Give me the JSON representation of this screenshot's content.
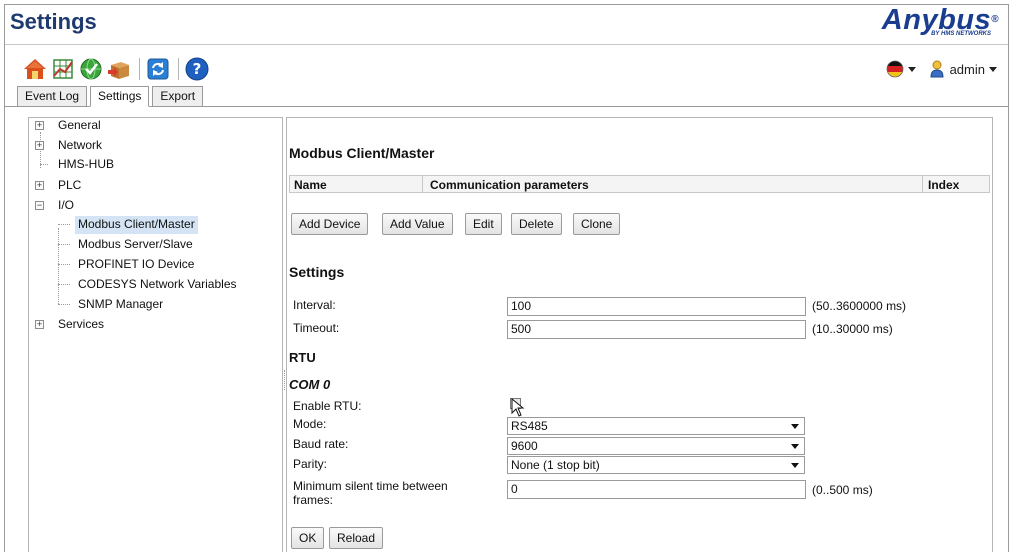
{
  "app": {
    "title": "Settings",
    "logo_text": "Anybus",
    "logo_reg": "®",
    "logo_subtitle": "BY HMS NETWORKS"
  },
  "toolbar": {
    "icons": [
      "home-icon",
      "io-grid-icon",
      "globe-check-icon",
      "box-arrow-icon",
      "refresh-icon",
      "help-icon"
    ]
  },
  "user": {
    "language_icon": "flag-germany-icon",
    "name": "admin"
  },
  "tabs": [
    {
      "label": "Event Log",
      "active": false
    },
    {
      "label": "Settings",
      "active": true
    },
    {
      "label": "Export",
      "active": false
    }
  ],
  "tree": {
    "items": [
      {
        "label": "General",
        "expander": "+"
      },
      {
        "label": "Network",
        "expander": "+"
      },
      {
        "label": "HMS-HUB",
        "expander": ""
      },
      {
        "label": "PLC",
        "expander": "+"
      },
      {
        "label": "I/O",
        "expander": "−"
      },
      {
        "label": "Modbus Client/Master",
        "selected": true
      },
      {
        "label": "Modbus Server/Slave"
      },
      {
        "label": "PROFINET IO Device"
      },
      {
        "label": "CODESYS Network Variables"
      },
      {
        "label": "SNMP Manager"
      },
      {
        "label": "Services",
        "expander": "+"
      }
    ]
  },
  "main": {
    "heading": "Modbus Client/Master",
    "table_headers": [
      "Name",
      "Communication parameters",
      "Index"
    ],
    "buttons": [
      "Add Device",
      "Add Value",
      "Edit",
      "Delete",
      "Clone"
    ],
    "settings_heading": "Settings",
    "interval": {
      "label": "Interval:",
      "value": "100",
      "range": "(50..3600000 ms)"
    },
    "timeout": {
      "label": "Timeout:",
      "value": "500",
      "range": "(10..30000 ms)"
    },
    "rtu_heading": "RTU",
    "com_heading": "COM 0",
    "enable_rtu": {
      "label": "Enable RTU:",
      "checked": false
    },
    "mode": {
      "label": "Mode:",
      "value": "RS485"
    },
    "baud": {
      "label": "Baud rate:",
      "value": "9600"
    },
    "parity": {
      "label": "Parity:",
      "value": "None (1 stop bit)"
    },
    "silent": {
      "label_line1": "Minimum silent time between",
      "label_line2": "frames:",
      "value": "0",
      "range": "(0..500 ms)"
    },
    "ok_label": "OK",
    "reload_label": "Reload"
  }
}
